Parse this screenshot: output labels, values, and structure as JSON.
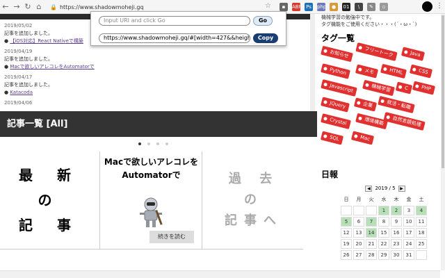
{
  "browser": {
    "url": "https://www.shadowmoheji.gq",
    "extensions": [
      {
        "icon": "ext-grid-icon",
        "label": "▪",
        "color": "#666666"
      },
      {
        "icon": "ext-adblock-icon",
        "label": "ABP",
        "color": "#d63b2f"
      },
      {
        "icon": "ext-ps-icon",
        "label": "Ps",
        "color": "#1f6fb5"
      },
      {
        "icon": "ext-php-icon",
        "label": "php",
        "color": "#6e7ab8"
      },
      {
        "icon": "ext-cookie-icon",
        "label": "●",
        "color": "#d79a3a"
      },
      {
        "icon": "ext-01-icon",
        "label": "01",
        "color": "#222222"
      },
      {
        "icon": "ext-slash-icon",
        "label": "\\",
        "color": "#444444"
      },
      {
        "icon": "ext-pen-icon",
        "label": "✎",
        "color": "#888888"
      },
      {
        "icon": "ext-box-icon",
        "label": "▫",
        "color": "#999999"
      }
    ]
  },
  "popup": {
    "input_placeholder": "Input URI and click Go",
    "go_label": "Go",
    "output_value": "https://www.shadowmoheji.gq/#[width=427&&height=",
    "copy_label": "Copy"
  },
  "news": [
    {
      "date": "2019/05/02",
      "text": "記事を追加しました。",
      "link": "【iOS対応】React Nativeで構築"
    },
    {
      "date": "2019/04/19",
      "text": "記事を追加しました。",
      "link": "Macで欲しいアレコレをAutomatorで"
    },
    {
      "date": "2019/04/17",
      "text": "記事を追加しました。",
      "link": "Katacoda"
    },
    {
      "date": "2019/04/06",
      "text": "",
      "link": ""
    }
  ],
  "articles_heading": "記事一覧 [All]",
  "cards": {
    "latest_lines": [
      "最 新",
      "の",
      "記 事"
    ],
    "mid_title": "Macで欲しいアレコレをAutomatorで",
    "read_more": "続きを読む",
    "past_lines": [
      "過 去",
      "の",
      "記事へ"
    ]
  },
  "sidebar": {
    "intro_lines": [
      "機械学習の勉強中です。",
      "タグ機能をご使用ください・・・(´・ω・`)"
    ],
    "tags_title": "タグ一覧",
    "tags": [
      "お知らせ",
      "フリートーク",
      "Java",
      "Python",
      "メモ",
      "HTML",
      "CSS",
      "Javascript",
      "機械学習",
      "C",
      "PHP",
      "JQuery",
      "企業",
      "就活・転職",
      "Crystal",
      "環境構築",
      "自然言語処理",
      "SQL",
      "Mac"
    ],
    "calendar_title": "日報",
    "month_label": "2019 / 5",
    "weekdays": [
      "日",
      "月",
      "火",
      "水",
      "木",
      "金",
      "土"
    ],
    "weeks": [
      [
        "",
        "",
        "",
        "1",
        "2",
        "3",
        "4"
      ],
      [
        "5",
        "6",
        "7",
        "8",
        "9",
        "10",
        "11"
      ],
      [
        "12",
        "13",
        "14",
        "15",
        "16",
        "17",
        "18"
      ],
      [
        "19",
        "20",
        "21",
        "22",
        "23",
        "24",
        "25"
      ],
      [
        "26",
        "27",
        "28",
        "29",
        "30",
        "31",
        ""
      ]
    ],
    "highlighted_days": [
      "1",
      "2",
      "4",
      "5",
      "7",
      "14"
    ]
  }
}
